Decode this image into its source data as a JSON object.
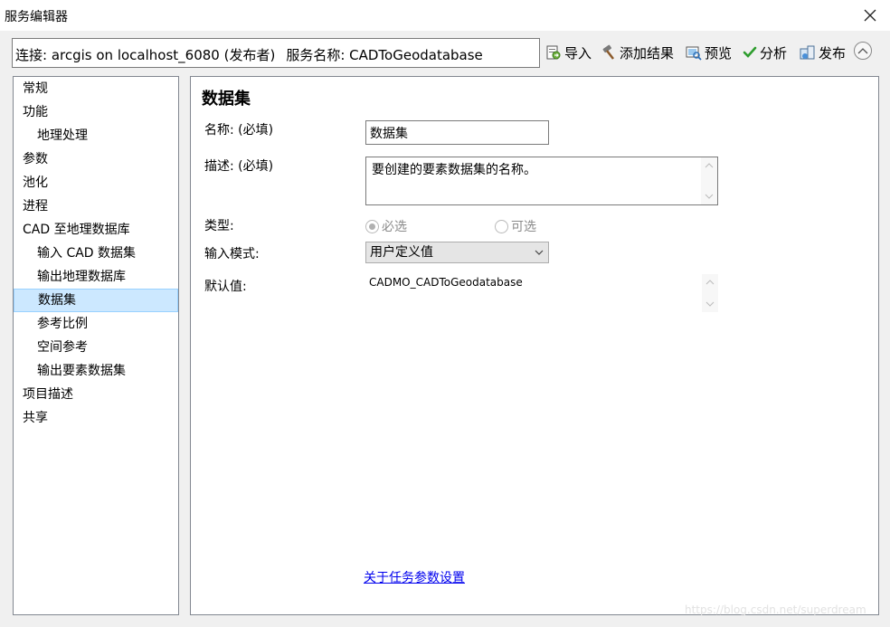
{
  "window": {
    "title": "服务编辑器"
  },
  "connection": {
    "label": "连接: arcgis on localhost_6080 (发布者)",
    "service_label": "服务名称: CADToGeodatabase"
  },
  "toolbar": {
    "import_label": "导入",
    "add_result_label": "添加结果",
    "preview_label": "预览",
    "analyze_label": "分析",
    "publish_label": "发布"
  },
  "sidebar": {
    "items": [
      {
        "label": "常规",
        "indent": 0
      },
      {
        "label": "功能",
        "indent": 0
      },
      {
        "label": "地理处理",
        "indent": 1
      },
      {
        "label": "参数",
        "indent": 0
      },
      {
        "label": "池化",
        "indent": 0
      },
      {
        "label": "进程",
        "indent": 0
      },
      {
        "label": "CAD 至地理数据库",
        "indent": 0
      },
      {
        "label": "输入 CAD 数据集",
        "indent": 1
      },
      {
        "label": "输出地理数据库",
        "indent": 1
      },
      {
        "label": "数据集",
        "indent": 1,
        "selected": true
      },
      {
        "label": "参考比例",
        "indent": 1
      },
      {
        "label": "空间参考",
        "indent": 1
      },
      {
        "label": "输出要素数据集",
        "indent": 1
      },
      {
        "label": "项目描述",
        "indent": 0
      },
      {
        "label": "共享",
        "indent": 0
      }
    ]
  },
  "main": {
    "title": "数据集",
    "name_label": "名称: (必填)",
    "name_value": "数据集",
    "desc_label": "描述: (必填)",
    "desc_value": "要创建的要素数据集的名称。",
    "type_label": "类型:",
    "type_required": "必选",
    "type_optional": "可选",
    "input_mode_label": "输入模式:",
    "input_mode_value": "用户定义值",
    "default_label": "默认值:",
    "default_value": "CADMO_CADToGeodatabase",
    "help_link": "关于任务参数设置"
  },
  "watermark": "https://blog.csdn.net/superdream",
  "colors": {
    "selection_bg": "#cce8ff",
    "selection_border": "#99d1ff",
    "link": "#0000ee"
  }
}
